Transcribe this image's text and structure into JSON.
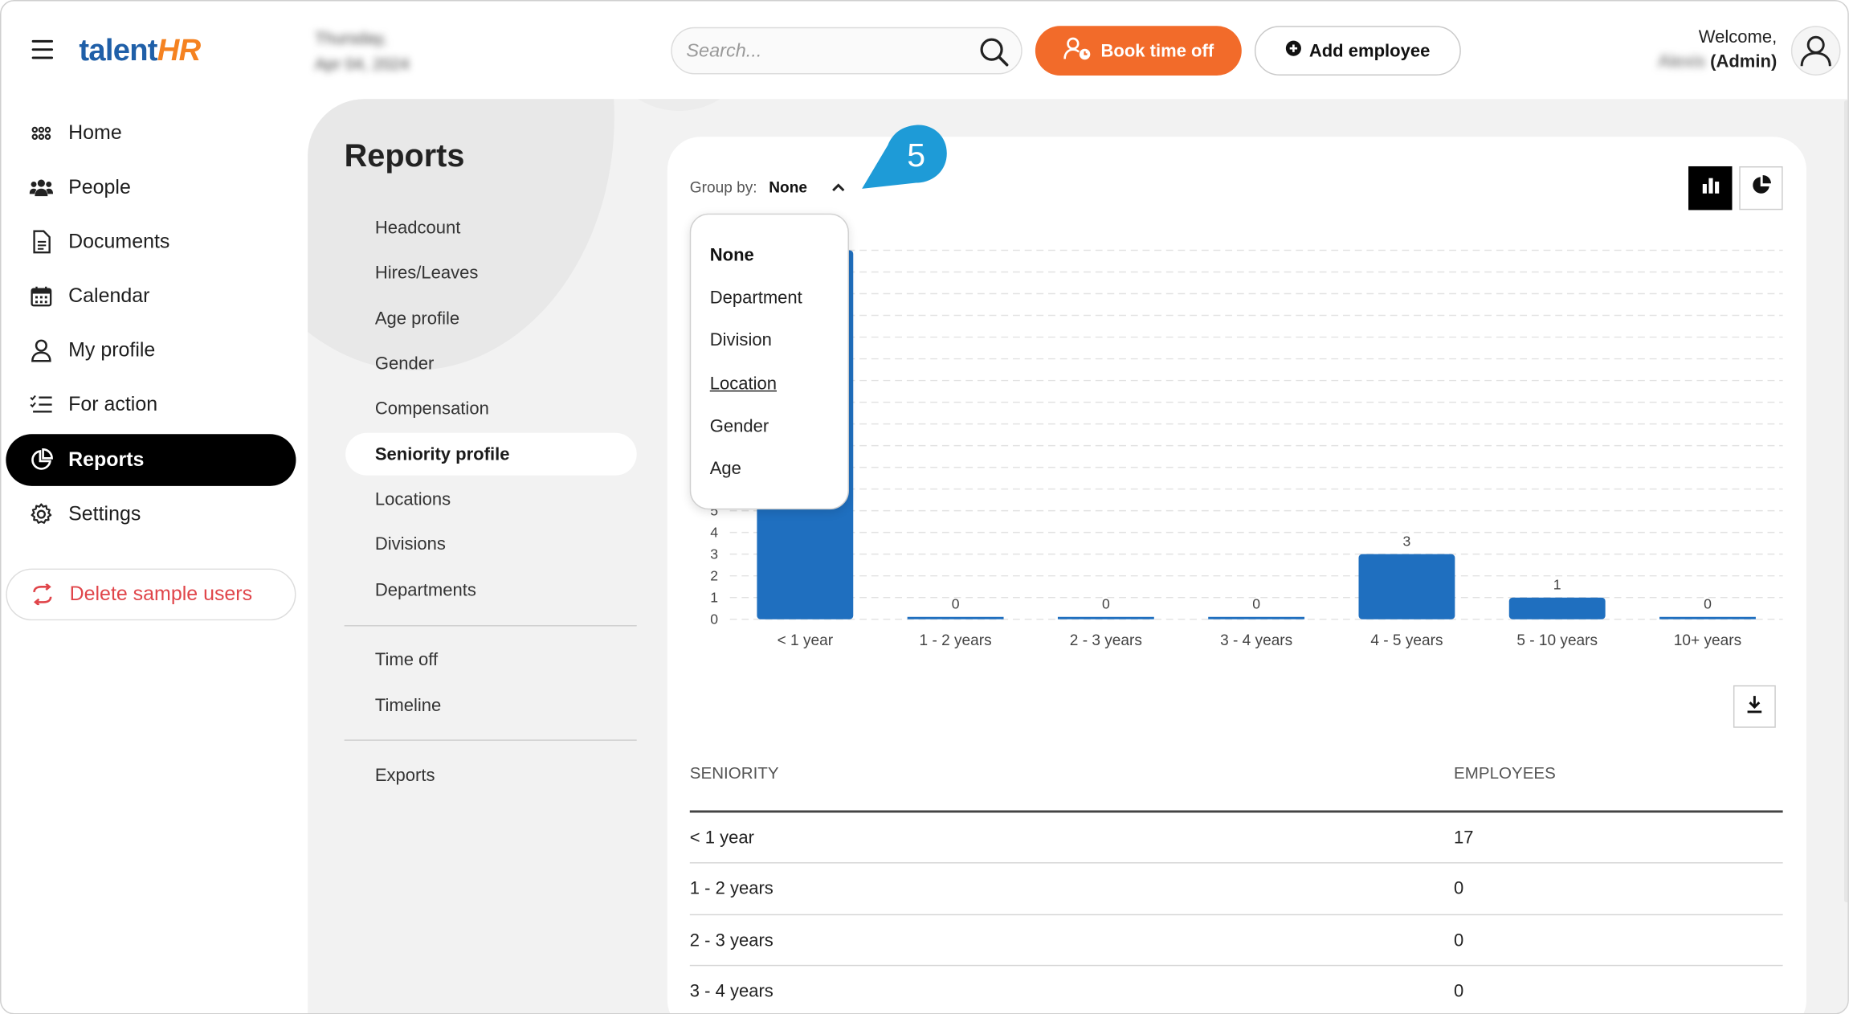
{
  "header": {
    "logo_a": "talent",
    "logo_b": "HR",
    "date_line1": "Thursday,",
    "date_line2": "Apr 04, 2024",
    "search_placeholder": "Search...",
    "book_label": "Book time off",
    "add_label": "Add employee",
    "welcome": "Welcome,",
    "user_name": "Alexis",
    "user_role": "(Admin)"
  },
  "sidebar": {
    "items": [
      {
        "label": "Home",
        "icon": "grid-icon"
      },
      {
        "label": "People",
        "icon": "people-icon"
      },
      {
        "label": "Documents",
        "icon": "document-icon"
      },
      {
        "label": "Calendar",
        "icon": "calendar-icon"
      },
      {
        "label": "My profile",
        "icon": "user-icon"
      },
      {
        "label": "For action",
        "icon": "checklist-icon"
      },
      {
        "label": "Reports",
        "icon": "pie-chart-icon",
        "active": true
      },
      {
        "label": "Settings",
        "icon": "gear-icon"
      }
    ],
    "delete_label": "Delete sample users"
  },
  "reports": {
    "title": "Reports",
    "items": [
      "Headcount",
      "Hires/Leaves",
      "Age profile",
      "Gender",
      "Compensation",
      "Seniority profile",
      "Locations",
      "Divisions",
      "Departments"
    ],
    "items2": [
      "Time off",
      "Timeline"
    ],
    "items3": [
      "Exports"
    ],
    "active": "Seniority profile"
  },
  "groupby": {
    "label": "Group by:",
    "value": "None",
    "options": [
      "None",
      "Department",
      "Division",
      "Location",
      "Gender",
      "Age"
    ]
  },
  "callout": "5",
  "chart_data": {
    "type": "bar",
    "categories": [
      "< 1 year",
      "1 - 2 years",
      "2 - 3 years",
      "3 - 4 years",
      "4 - 5 years",
      "5 - 10 years",
      "10+ years"
    ],
    "values": [
      17,
      0,
      0,
      0,
      3,
      1,
      0
    ],
    "ylim": [
      0,
      17
    ],
    "visible_y_ticks": [
      0,
      1,
      2,
      3,
      4,
      5
    ],
    "grid": true,
    "bar_color": "#1f6fbf"
  },
  "table": {
    "headers": [
      "Seniority",
      "Employees"
    ],
    "rows": [
      [
        "< 1 year",
        "17"
      ],
      [
        "1 - 2 years",
        "0"
      ],
      [
        "2 - 3 years",
        "0"
      ],
      [
        "3 - 4 years",
        "0"
      ]
    ]
  },
  "colors": {
    "accent": "#f26b2a",
    "brand_blue": "#1f5fa8",
    "danger": "#e0454a",
    "callout": "#1e9bd7"
  }
}
